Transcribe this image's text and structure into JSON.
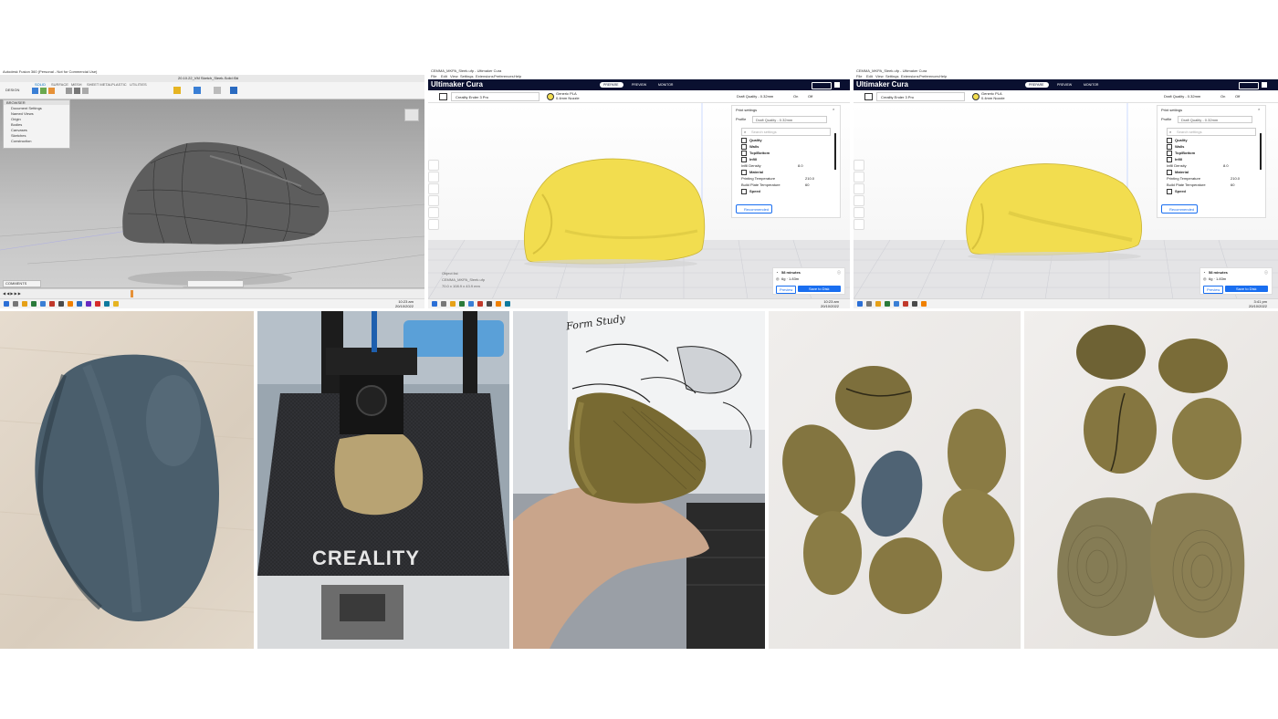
{
  "fusion": {
    "title": "Autodesk Fusion 360 (Personal - Not for Commercial Use)",
    "doc_tab": "20.10.22_VM Sketch_Sleek-Solid.f3d",
    "toolbar_tabs": [
      "SOLID",
      "SURFACE",
      "MESH",
      "SHEET METAL",
      "PLASTIC",
      "UTILITIES"
    ],
    "design_button": "DESIGN",
    "browser_title": "BROWSER",
    "browser_items": [
      "Document Settings",
      "Named Views",
      "Origin",
      "Bodies",
      "Canvases",
      "Sketches",
      "Construction"
    ],
    "comments_label": "COMMENTS",
    "time": "10:23 am",
    "date": "20/10/2022"
  },
  "cura1": {
    "title": "CEMMA_MKPA_Sleek.ufp - Ultimaker Cura",
    "menu": [
      "File",
      "Edit",
      "View",
      "Settings",
      "Extensions",
      "Preferences",
      "Help"
    ],
    "logo": "Ultimaker Cura",
    "stages": [
      "PREPARE",
      "PREVIEW",
      "MONITOR"
    ],
    "printer": "Creality Ender 3 Pro",
    "material_line1": "Generic PLA",
    "material_line2": "0.4mm Nozzle",
    "quality": "Draft Quality - 0.32mm",
    "support": "On",
    "adhesion": "Off",
    "print_settings_title": "Print settings",
    "profile_label": "Profile",
    "profile_value": "Draft Quality - 0.32mm",
    "search_placeholder": "Search settings",
    "categories": [
      "Quality",
      "Walls",
      "Top/Bottom",
      "Infill",
      "Material",
      "Speed"
    ],
    "infill_label": "Infill Density",
    "infill_value": "8.0",
    "temp_label": "Printing Temperature",
    "temp_value": "210.0",
    "bed_label": "Build Plate Temperature",
    "bed_value": "60",
    "recommended_button": "Recommended",
    "object_list": "Object list",
    "object_name": "CEMMA_MKPA_Sleek.ufp",
    "dims": "70.0 x 108.9 x 43.9 mm",
    "estimate_time": "58 minutes",
    "estimate_material": "6g · 1.83m",
    "preview_button": "Preview",
    "save_button": "Save to Disk",
    "time": "10:23 am",
    "date": "20/10/2022"
  },
  "cura2": {
    "title": "CEMMA_MKPA_Sleek.ufp - Ultimaker Cura",
    "menu": [
      "File",
      "Edit",
      "View",
      "Settings",
      "Extensions",
      "Preferences",
      "Help"
    ],
    "logo": "Ultimaker Cura",
    "stages": [
      "PREPARE",
      "PREVIEW",
      "MONITOR"
    ],
    "printer": "Creality Ender 3 Pro",
    "material_line1": "Generic PLA",
    "material_line2": "0.4mm Nozzle",
    "quality": "Draft Quality - 0.32mm",
    "support": "On",
    "adhesion": "Off",
    "print_settings_title": "Print settings",
    "profile_label": "Profile",
    "profile_value": "Draft Quality - 0.32mm",
    "search_placeholder": "Search settings",
    "categories": [
      "Quality",
      "Walls",
      "Top/Bottom",
      "Infill",
      "Material",
      "Speed"
    ],
    "infill_label": "Infill Density",
    "infill_value": "8.0",
    "temp_label": "Printing Temperature",
    "temp_value": "210.0",
    "bed_label": "Build Plate Temperature",
    "bed_value": "60",
    "recommended_button": "Recommended",
    "estimate_time": "58 minutes",
    "estimate_material": "6g · 1.83m",
    "preview_button": "Preview",
    "save_button": "Save to Disk",
    "time": "3:41 pm",
    "date": "20/10/2022"
  },
  "photos": {
    "printer_brand": "CREALITY",
    "sketch_text": "Form Study"
  },
  "colors": {
    "cura_navy": "#0a1030",
    "cura_blue": "#196ef0",
    "model_yellow": "#f2dd4f",
    "clay_gray": "#4a5e6c",
    "pla_gold": "#8a7b40"
  }
}
